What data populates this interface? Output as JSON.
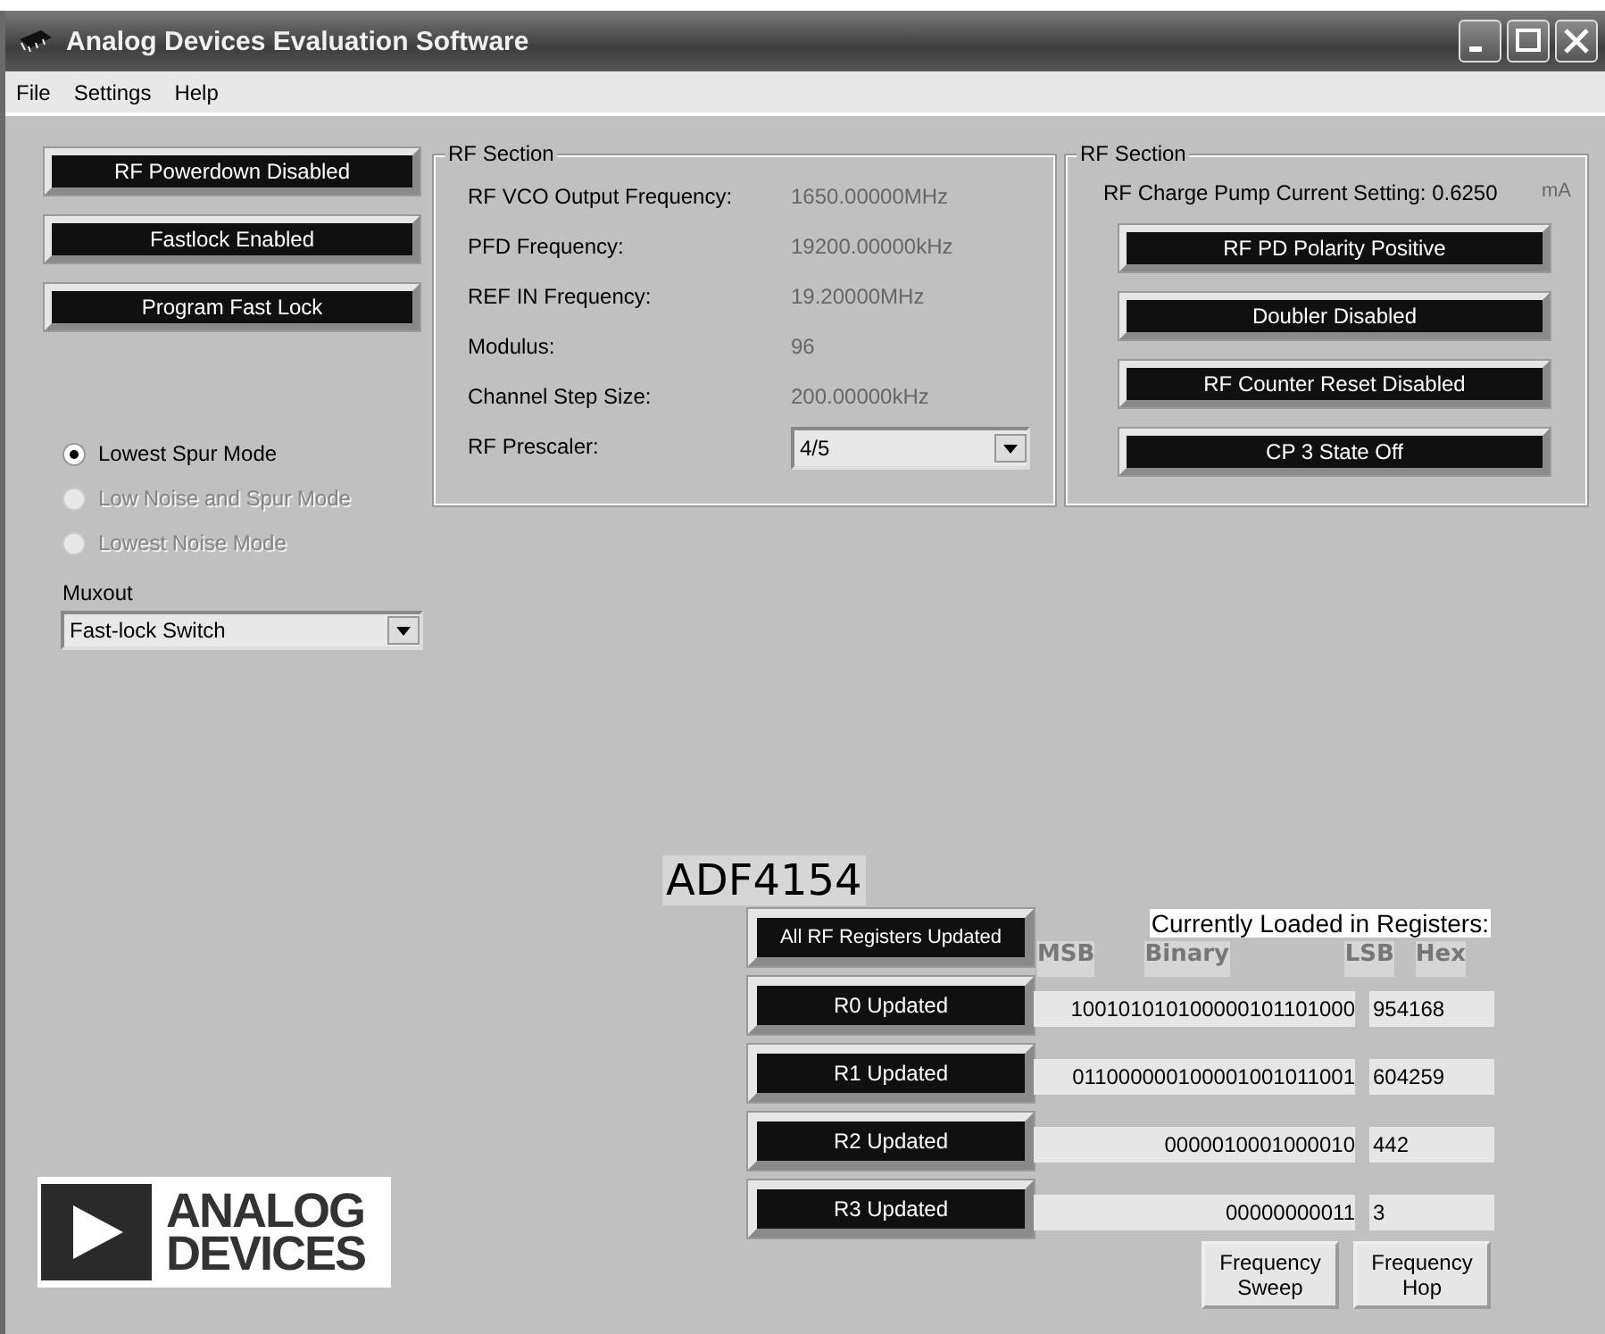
{
  "window": {
    "title": "Analog Devices Evaluation Software"
  },
  "menu": [
    "File",
    "Settings",
    "Help"
  ],
  "left_buttons": [
    "RF Powerdown Disabled",
    "Fastlock Enabled",
    "Program Fast Lock"
  ],
  "modes": [
    {
      "label": "Lowest Spur Mode",
      "selected": true,
      "disabled": false
    },
    {
      "label": "Low Noise and Spur Mode",
      "selected": false,
      "disabled": true
    },
    {
      "label": "Lowest Noise Mode",
      "selected": false,
      "disabled": true
    }
  ],
  "muxout": {
    "label": "Muxout",
    "value": "Fast-lock Switch"
  },
  "rf_section": {
    "title": "RF Section",
    "fields": [
      {
        "label": "RF VCO Output Frequency:",
        "value": "1650.00000MHz"
      },
      {
        "label": "PFD Frequency:",
        "value": "19200.00000kHz"
      },
      {
        "label": "REF IN Frequency:",
        "value": "19.20000MHz"
      },
      {
        "label": "Modulus:",
        "value": "96"
      },
      {
        "label": "Channel Step Size:",
        "value": "200.00000kHz"
      }
    ],
    "prescaler": {
      "label": "RF Prescaler:",
      "value": "4/5"
    }
  },
  "rf_section_2": {
    "title": "RF Section",
    "charge_pump": {
      "label": "RF Charge Pump Current Setting: 0.6250",
      "unit": "mA"
    },
    "buttons": [
      "RF PD Polarity Positive",
      "Doubler Disabled",
      "RF Counter Reset Disabled",
      "CP 3 State Off"
    ]
  },
  "device_label": "ADF4154",
  "logo": {
    "line1": "ANALOG",
    "line2": "DEVICES"
  },
  "registers": {
    "all_button": "All RF Registers Updated",
    "heading": "Currently Loaded in Registers:",
    "columns": [
      "MSB",
      "Binary",
      "LSB",
      "Hex"
    ],
    "rows": [
      {
        "button": "R0 Updated",
        "binary": "100101010100000101101000",
        "hex": "954168"
      },
      {
        "button": "R1 Updated",
        "binary": "011000000100001001011001",
        "hex": "604259"
      },
      {
        "button": "R2 Updated",
        "binary": "0000010001000010",
        "hex": "442"
      },
      {
        "button": "R3 Updated",
        "binary": "00000000011",
        "hex": "3"
      }
    ]
  },
  "actions": [
    "Frequency Sweep",
    "Frequency Hop"
  ]
}
